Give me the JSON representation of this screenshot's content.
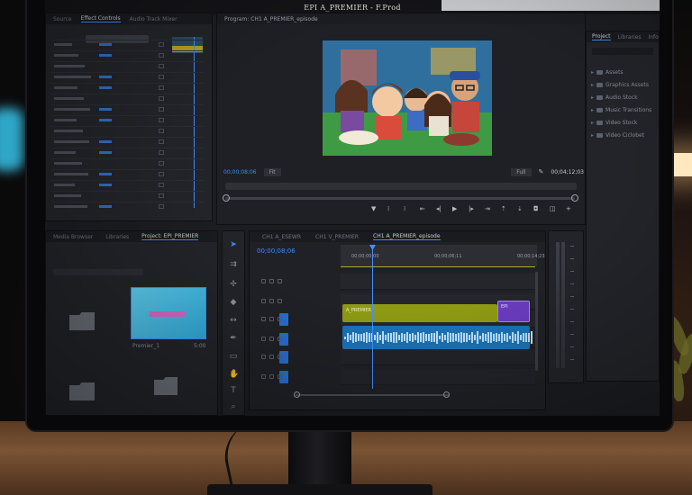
{
  "window": {
    "title": "EPI A_PREMIER - F.Prod"
  },
  "source_panel": {
    "tabs": [
      "Source",
      "Effect Controls",
      "Audio Track Mixer"
    ],
    "active_tab": "Effect Controls"
  },
  "program_monitor": {
    "tab": "Program: CH1 A_PREMIER_episode",
    "timecode_left": "00;00;08;06",
    "fit_label": "Fit",
    "quality_label": "Full",
    "timecode_right": "00;04;12;03"
  },
  "project_panel": {
    "tabs": [
      "Project",
      "Libraries",
      "Info"
    ],
    "items": [
      {
        "label": "Assets",
        "icon": "folder-icon"
      },
      {
        "label": "Graphics Assets",
        "icon": "folder-icon"
      },
      {
        "label": "Audio Stock",
        "icon": "folder-icon"
      },
      {
        "label": "Music Transitions",
        "icon": "folder-icon"
      },
      {
        "label": "Video Stock",
        "icon": "folder-icon"
      },
      {
        "label": "Video Ciclobet",
        "icon": "folder-icon"
      }
    ]
  },
  "media_browser": {
    "tabs": [
      "Media Browser",
      "Libraries",
      "Project: EPI_PREMIER"
    ],
    "clip_name": "Premier_1",
    "clip_duration": "5:00"
  },
  "timeline": {
    "tabs": [
      "CH1 A_ESEWR",
      "CH1 V_PREMIER",
      "CH1 A_PREMIER_episode"
    ],
    "active_tab": "CH1 A_PREMIER_episode",
    "timecode": "00;00;08;06",
    "ruler_labels": [
      "00;00;00;00",
      "00;00;06;11",
      "00;00;14;23"
    ],
    "clips": [
      {
        "label": "A_PREMIER",
        "color": "#8f9a14",
        "track": "V1"
      },
      {
        "label": "EPI",
        "color": "#6b3cc0",
        "track": "V1"
      },
      {
        "label": "",
        "color": "#1b74b8",
        "track": "A1"
      }
    ]
  },
  "colors": {
    "accent_blue": "#3d8bff",
    "playhead": "#4a90ff",
    "clip_video": "#8f9a14",
    "clip_purple": "#6b3cc0",
    "clip_audio": "#1b74b8"
  },
  "controls": {
    "transport_icons": [
      "marker-icon",
      "in-point-icon",
      "out-point-icon",
      "go-to-in-icon",
      "step-back-icon",
      "play-icon",
      "step-forward-icon",
      "go-to-out-icon",
      "lift-icon",
      "extract-icon",
      "export-frame-icon",
      "comparison-icon",
      "add-icon"
    ]
  }
}
